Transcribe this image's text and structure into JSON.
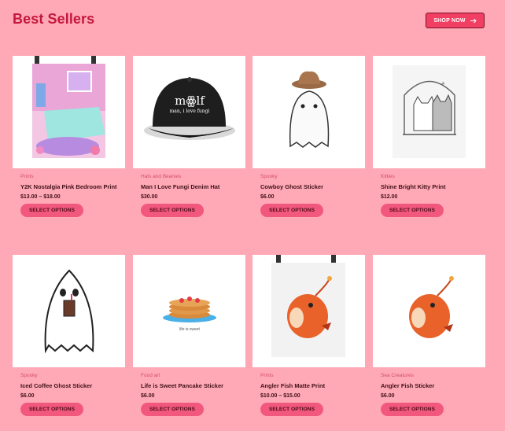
{
  "section": {
    "title": "Best Sellers",
    "shop_now_label": "SHOP NOW"
  },
  "products": [
    {
      "category": "Prints",
      "name": "Y2K Nostalgia Pink Bedroom Print",
      "price": "$13.00 – $18.00",
      "button": "SELECT OPTIONS",
      "image_icon": "pink-bedroom-print-icon"
    },
    {
      "category": "Hats and Beanies",
      "name": "Man I Love Fungi Denim Hat",
      "price": "$30.00",
      "button": "SELECT OPTIONS",
      "image_icon": "black-cap-icon"
    },
    {
      "category": "Spooky",
      "name": "Cowboy Ghost Sticker",
      "price": "$6.00",
      "button": "SELECT OPTIONS",
      "image_icon": "cowboy-ghost-icon"
    },
    {
      "category": "Kitties",
      "name": "Shine Bright Kitty Print",
      "price": "$12.00",
      "button": "SELECT OPTIONS",
      "image_icon": "kitty-sketch-icon"
    },
    {
      "category": "Spooky",
      "name": "Iced Coffee Ghost Sticker",
      "price": "$6.00",
      "button": "SELECT OPTIONS",
      "image_icon": "coffee-ghost-icon"
    },
    {
      "category": "Food art",
      "name": "Life is Sweet Pancake Sticker",
      "price": "$6.00",
      "button": "SELECT OPTIONS",
      "image_icon": "pancake-stack-icon"
    },
    {
      "category": "Prints",
      "name": "Angler Fish Matte Print",
      "price": "$10.00 – $15.00",
      "button": "SELECT OPTIONS",
      "image_icon": "angler-fish-print-icon"
    },
    {
      "category": "Sea Creatures",
      "name": "Angler Fish Sticker",
      "price": "$6.00",
      "button": "SELECT OPTIONS",
      "image_icon": "angler-fish-icon"
    }
  ],
  "hat_text": {
    "line1": "mꙮlf",
    "line2": "man, i love fungi"
  },
  "pancake_caption": "life is sweet",
  "colors": {
    "background": "#ffa9b6",
    "title": "#c4173d",
    "button": "#f2587d",
    "shop_button": "#f13e63"
  }
}
